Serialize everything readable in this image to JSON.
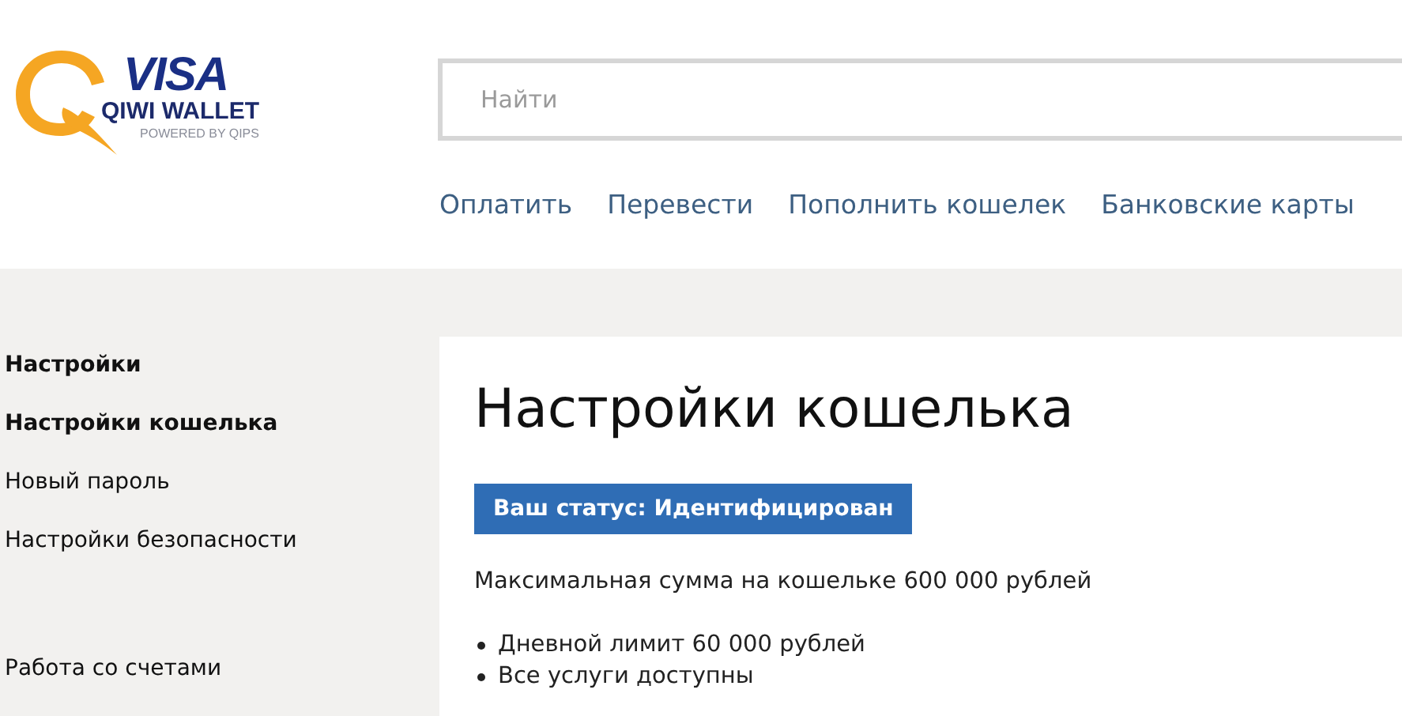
{
  "logo": {
    "brand": "VISA",
    "product": "QIWI WALLET",
    "tagline": "POWERED BY QIPS"
  },
  "search": {
    "placeholder": "Найти"
  },
  "nav": [
    "Оплатить",
    "Перевести",
    "Пополнить кошелек",
    "Банковские карты"
  ],
  "sidebar": {
    "items": [
      {
        "kind": "heading",
        "label": "Настройки"
      },
      {
        "kind": "item",
        "label": "Настройки кошелька",
        "selected": true
      },
      {
        "kind": "item",
        "label": "Новый пароль",
        "selected": false
      },
      {
        "kind": "item",
        "label": "Настройки безопасности",
        "selected": false
      },
      {
        "kind": "gap"
      },
      {
        "kind": "item",
        "label": "Работа со счетами",
        "selected": false
      }
    ]
  },
  "content": {
    "title": "Настройки кошелька",
    "status": "Ваш статус: Идентифицирован",
    "summary": "Максимальная сумма на кошельке 600 000 рублей",
    "bullets": [
      "Дневной лимит 60 000 рублей",
      "Все услуги доступны"
    ]
  }
}
